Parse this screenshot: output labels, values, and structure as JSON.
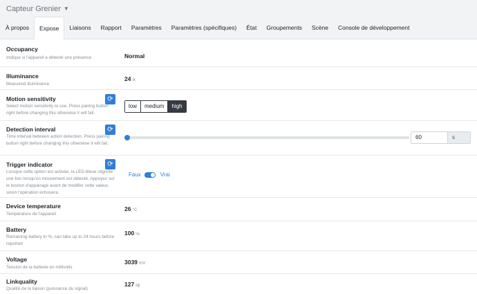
{
  "header": {
    "device_name": "Capteur Grenier",
    "caret_icon": "chevron-down-icon"
  },
  "tabs": [
    {
      "label": "À propos"
    },
    {
      "label": "Expose"
    },
    {
      "label": "Liaisons"
    },
    {
      "label": "Rapport"
    },
    {
      "label": "Paramètres"
    },
    {
      "label": "Paramètres (spécifiques)"
    },
    {
      "label": "État"
    },
    {
      "label": "Groupements"
    },
    {
      "label": "Scène"
    },
    {
      "label": "Console de développement"
    }
  ],
  "active_tab": "Expose",
  "colors": {
    "accent": "#2f7fd6",
    "dark": "#343a40"
  },
  "rows": {
    "occupancy": {
      "title": "Occupancy",
      "desc": "Indique si l'appareil a détecté une présence",
      "value": "Normal"
    },
    "illuminance": {
      "title": "Illuminance",
      "desc": "Measured illuminance",
      "value": "24",
      "unit": "lx"
    },
    "motion": {
      "title": "Motion sensitivity",
      "desc": "Select motion sensitivity to use. Press pairing button right before changing this otherwise it will fail.",
      "options": [
        "low",
        "medium",
        "high"
      ],
      "selected": "high"
    },
    "interval": {
      "title": "Detection interval",
      "desc": "Time interval between action detection. Press pairing button right before changing this otherwise it will fail.",
      "value": "60",
      "unit": "s",
      "slider_fraction": 0
    },
    "trigger": {
      "title": "Trigger indicator",
      "desc": "Lorsque cette option est activée, la LED bleue clignote une fois lorsqu'un mouvement est détecté. Appuyez sur le bouton d'appairage avant de modifier cette valeur, sinon l'opération échouera.",
      "off_label": "Faux",
      "on_label": "Vrai",
      "state": "on"
    },
    "temperature": {
      "title": "Device temperature",
      "desc": "Température de l'appareil",
      "value": "26",
      "unit": "°C"
    },
    "battery": {
      "title": "Battery",
      "desc": "Remaining battery in %, can take up to 24 hours before reported",
      "value": "100",
      "unit": "%"
    },
    "voltage": {
      "title": "Voltage",
      "desc": "Tension de la batterie en millivolts",
      "value": "3039",
      "unit": "mV"
    },
    "linkquality": {
      "title": "Linkquality",
      "desc": "Qualité de la liaison (puissance du signal)",
      "value": "127",
      "unit": "lqi"
    }
  }
}
